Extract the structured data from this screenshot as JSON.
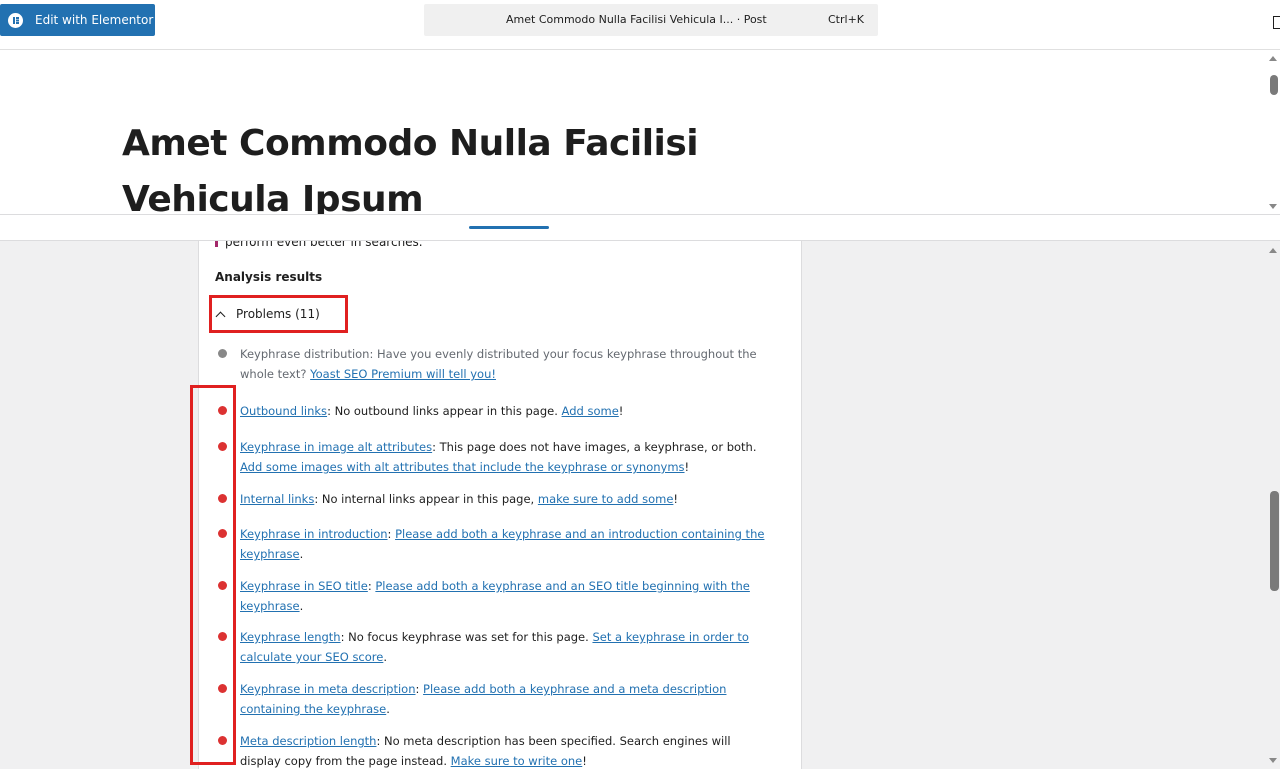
{
  "toolbar": {
    "elementor_label": "Edit with Elementor",
    "command_title": "Amet Commodo Nulla Facilisi Vehicula I... · Post",
    "command_shortcut": "Ctrl+K"
  },
  "editor": {
    "post_title": "Amet Commodo Nulla Facilisi Vehicula Ipsum"
  },
  "seo": {
    "cut_off_text": "perform even better in searches.",
    "analysis_title": "Analysis results",
    "problems_label": "Problems (11)",
    "results": [
      {
        "status": "grey",
        "link": "",
        "text": "Keyphrase distribution: Have you evenly distributed your focus keyphrase throughout the whole text? ",
        "action": "Yoast SEO Premium will tell you!",
        "end": ""
      },
      {
        "status": "red",
        "link": "Outbound links",
        "text": ": No outbound links appear in this page. ",
        "action": "Add some",
        "end": "!"
      },
      {
        "status": "red",
        "link": "Keyphrase in image alt attributes",
        "text": ": This page does not have images, a keyphrase, or both. ",
        "action": "Add some images with alt attributes that include the keyphrase or synonyms",
        "end": "!"
      },
      {
        "status": "red",
        "link": "Internal links",
        "text": ": No internal links appear in this page, ",
        "action": "make sure to add some",
        "end": "!"
      },
      {
        "status": "red",
        "link": "Keyphrase in introduction",
        "text": ": ",
        "action": "Please add both a keyphrase and an introduction containing the keyphrase",
        "end": "."
      },
      {
        "status": "red",
        "link": "Keyphrase in SEO title",
        "text": ": ",
        "action": "Please add both a keyphrase and an SEO title beginning with the keyphrase",
        "end": "."
      },
      {
        "status": "red",
        "link": "Keyphrase length",
        "text": ": No focus keyphrase was set for this page. ",
        "action": "Set a keyphrase in order to calculate your SEO score",
        "end": "."
      },
      {
        "status": "red",
        "link": "Keyphrase in meta description",
        "text": ": ",
        "action": "Please add both a keyphrase and a meta description containing the keyphrase",
        "end": "."
      },
      {
        "status": "red",
        "link": "Meta description length",
        "text": ": No meta description has been specified. Search engines will display copy from the page instead. ",
        "action": "Make sure to write one",
        "end": "!"
      }
    ]
  },
  "colors": {
    "accent": "#2271b1",
    "problem": "#dc3232",
    "highlight_box": "#e02020"
  }
}
